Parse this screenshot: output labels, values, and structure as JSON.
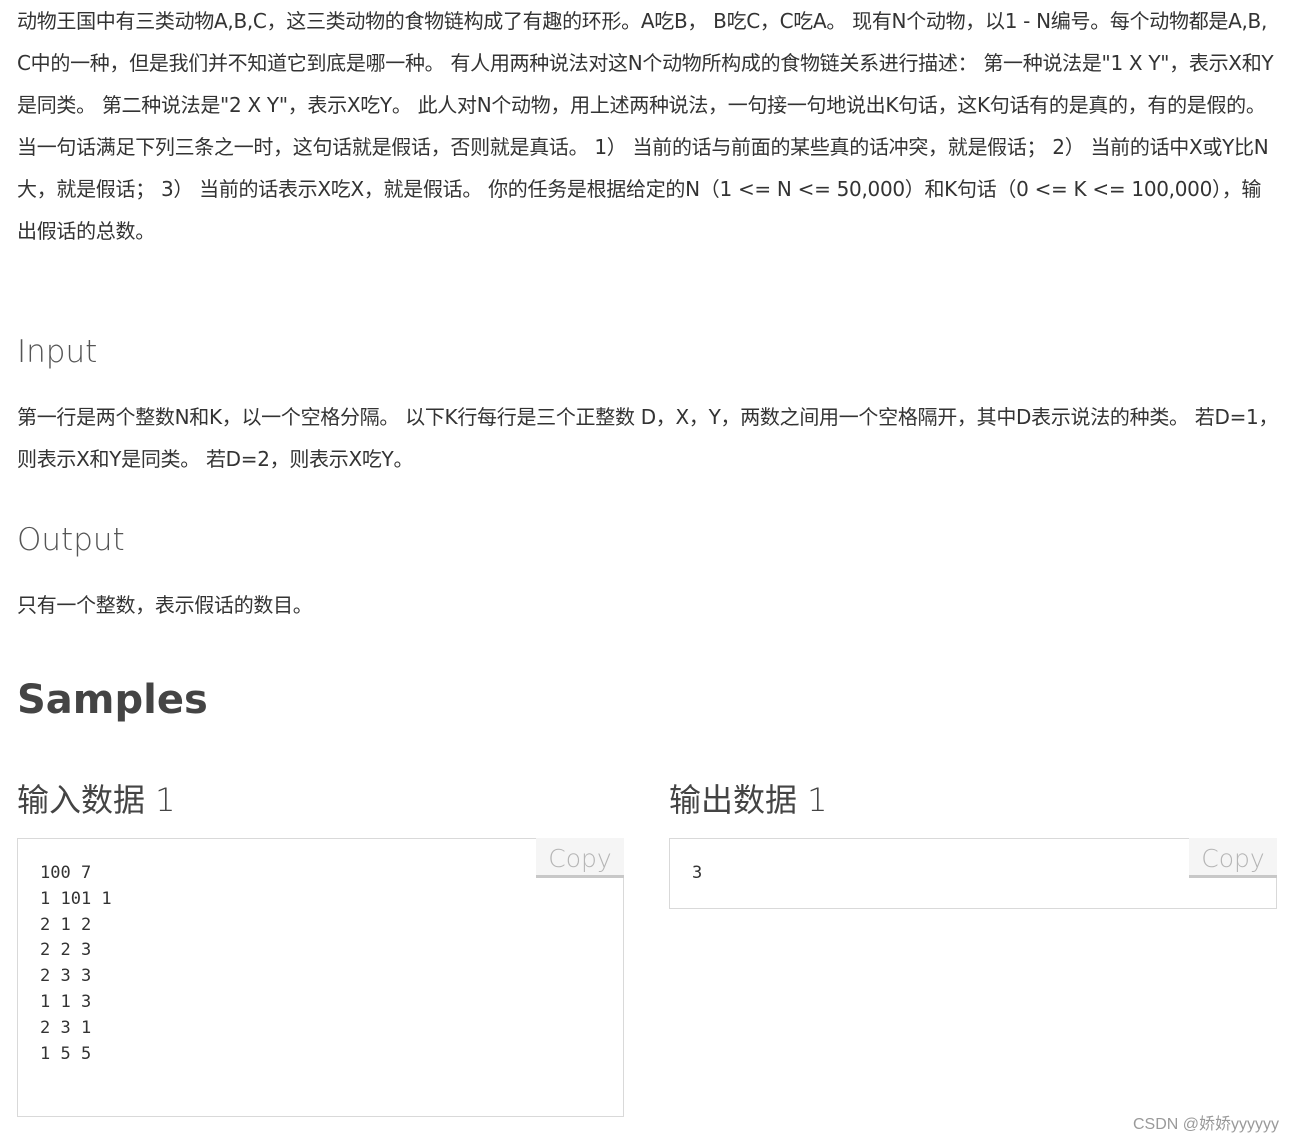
{
  "problem": {
    "description": "动物王国中有三类动物A,B,C，这三类动物的食物链构成了有趣的环形。A吃B， B吃C，C吃A。 现有N个动物，以1 - N编号。每个动物都是A,B,C中的一种，但是我们并不知道它到底是哪一种。 有人用两种说法对这N个动物所构成的食物链关系进行描述： 第一种说法是\"1 X Y\"，表示X和Y是同类。 第二种说法是\"2 X Y\"，表示X吃Y。 此人对N个动物，用上述两种说法，一句接一句地说出K句话，这K句话有的是真的，有的是假的。当一句话满足下列三条之一时，这句话就是假话，否则就是真话。 1） 当前的话与前面的某些真的话冲突，就是假话； 2） 当前的话中X或Y比N大，就是假话； 3） 当前的话表示X吃X，就是假话。 你的任务是根据给定的N（1 <= N <= 50,000）和K句话（0 <= K <= 100,000），输出假话的总数。",
    "input_heading": "Input",
    "input_text": "第一行是两个整数N和K，以一个空格分隔。 以下K行每行是三个正整数 D，X，Y，两数之间用一个空格隔开，其中D表示说法的种类。 若D=1，则表示X和Y是同类。 若D=2，则表示X吃Y。",
    "output_heading": "Output",
    "output_text": "只有一个整数，表示假话的数目。"
  },
  "samples": {
    "heading": "Samples",
    "input": {
      "title": "输入数据 1",
      "content": "100 7\n1 101 1\n2 1 2\n2 2 3\n2 3 3\n1 1 3\n2 3 1\n1 5 5",
      "copy_label": "Copy"
    },
    "output": {
      "title": "输出数据 1",
      "content": "3",
      "copy_label": "Copy"
    }
  },
  "watermark": "CSDN @娇娇yyyyyy"
}
